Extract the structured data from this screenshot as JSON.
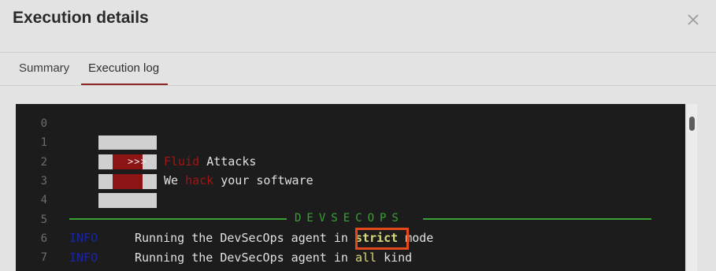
{
  "dialog": {
    "title": "Execution details",
    "close_icon": "close-icon"
  },
  "tabs": [
    {
      "label": "Summary",
      "active": false
    },
    {
      "label": "Execution log",
      "active": true
    }
  ],
  "log": {
    "line_numbers": [
      "0",
      "1",
      "2",
      "3",
      "4",
      "5",
      "6",
      "7"
    ],
    "banner": {
      "brand_fluid": "Fluid",
      "brand_attacks": "Attacks",
      "tagline_we": "We",
      "tagline_hack": "hack",
      "tagline_rest": "your software",
      "arrows": ">>>",
      "logo_icon": "fluid-attacks-logo"
    },
    "section_header": "DEVSECOPS",
    "lines": [
      {
        "level": "INFO",
        "message_prefix": "Running the DevSecOps agent in",
        "keyword": "strict",
        "message_suffix": "mode"
      },
      {
        "level": "INFO",
        "message_prefix": "Running the DevSecOps agent in",
        "keyword": "all",
        "message_suffix": "kind"
      }
    ]
  },
  "colors": {
    "accent_tab": "#8f2525",
    "brand_red": "#a31515",
    "section_green": "#3aa035",
    "info_blue": "#1a24a0",
    "keyword_yellow": "#d9d97a",
    "highlight_orange": "#e4491c",
    "log_background": "#1c1c1c"
  }
}
